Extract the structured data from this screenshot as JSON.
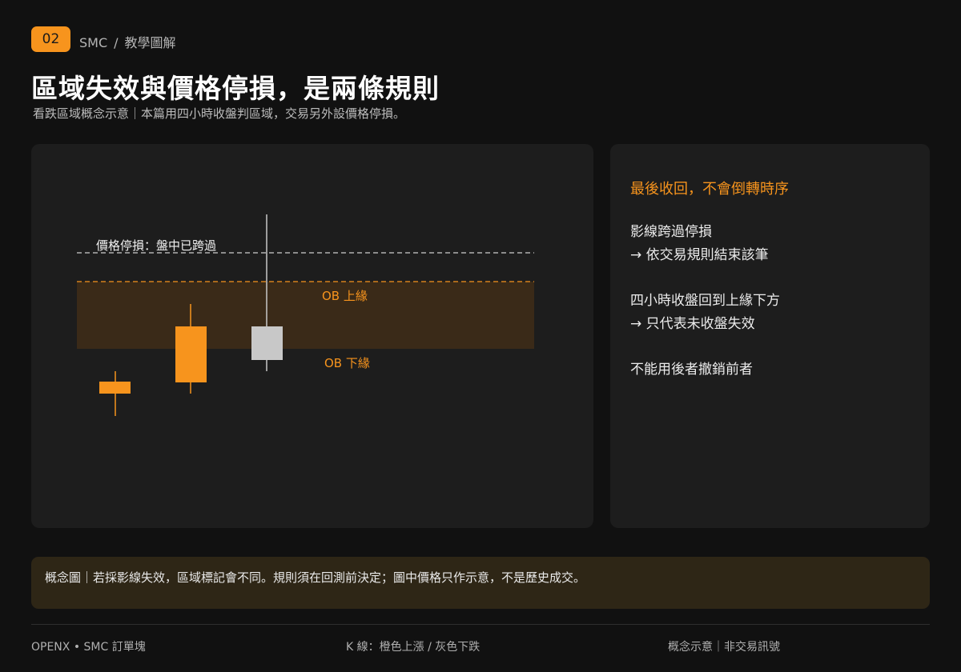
{
  "header": {
    "badge": "02",
    "breadcrumb": {
      "section": "SMC",
      "separator": "/",
      "page": "教學圖解"
    },
    "title": "區域失效與價格停損，是兩條規則",
    "subtitle": "看跌區域概念示意｜本篇用四小時收盤判區域，交易另外設價格停損。"
  },
  "diagram": {
    "labels": {
      "price_stop": "價格停損：盤中已跨過",
      "ob_upper": "OB 上緣",
      "ob_lower": "OB 下緣"
    },
    "colors": {
      "up_candle": "#f7941d",
      "down_candle": "#c8c8c8",
      "zone_fill": "#3a2a18",
      "stop_line": "#d0d0d0",
      "ob_line": "#f7941d"
    },
    "candles": [
      {
        "type": "up",
        "color": "orange"
      },
      {
        "type": "up",
        "color": "orange"
      },
      {
        "type": "down",
        "color": "gray"
      }
    ]
  },
  "notes": {
    "heading": "最後收回，不會倒轉時序",
    "items": [
      {
        "line1": "影線跨過停損",
        "line2": "→ 依交易規則結束該筆"
      },
      {
        "line1": "四小時收盤回到上緣下方",
        "line2": "→ 只代表未收盤失效"
      },
      {
        "line1": "不能用後者撤銷前者",
        "line2": ""
      }
    ]
  },
  "callout": "概念圖｜若採影線失效，區域標記會不同。規則須在回測前決定；圖中價格只作示意，不是歷史成交。",
  "footer": {
    "left": "OPENX • SMC 訂單塊",
    "middle": "K 線：橙色上漲 / 灰色下跌",
    "right": "概念示意｜非交易訊號"
  }
}
